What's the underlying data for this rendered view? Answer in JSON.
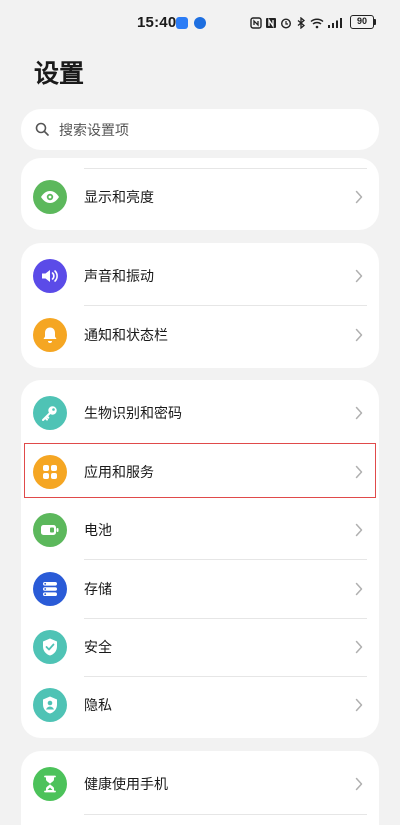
{
  "status_bar": {
    "time": "15:40",
    "battery": "90"
  },
  "page": {
    "title": "设置"
  },
  "search": {
    "placeholder": "搜索设置项"
  },
  "groups": [
    {
      "items": [
        {
          "label": "显示和亮度",
          "icon": "eye-icon",
          "color": "#5CB85C"
        }
      ]
    },
    {
      "items": [
        {
          "label": "声音和振动",
          "icon": "speaker-icon",
          "color": "#5B4BE8"
        },
        {
          "label": "通知和状态栏",
          "icon": "bell-icon",
          "color": "#F5A623"
        }
      ]
    },
    {
      "items": [
        {
          "label": "生物识别和密码",
          "icon": "key-icon",
          "color": "#4FC3B5"
        },
        {
          "label": "应用和服务",
          "icon": "apps-grid-icon",
          "color": "#F5A623"
        },
        {
          "label": "电池",
          "icon": "battery-icon",
          "color": "#5CB85C"
        },
        {
          "label": "存储",
          "icon": "storage-icon",
          "color": "#2A5BD7"
        },
        {
          "label": "安全",
          "icon": "shield-check-icon",
          "color": "#4FC3B5"
        },
        {
          "label": "隐私",
          "icon": "privacy-shield-icon",
          "color": "#4FC3B5"
        }
      ]
    },
    {
      "items": [
        {
          "label": "健康使用手机",
          "icon": "hourglass-icon",
          "color": "#4CC25A"
        }
      ]
    }
  ]
}
